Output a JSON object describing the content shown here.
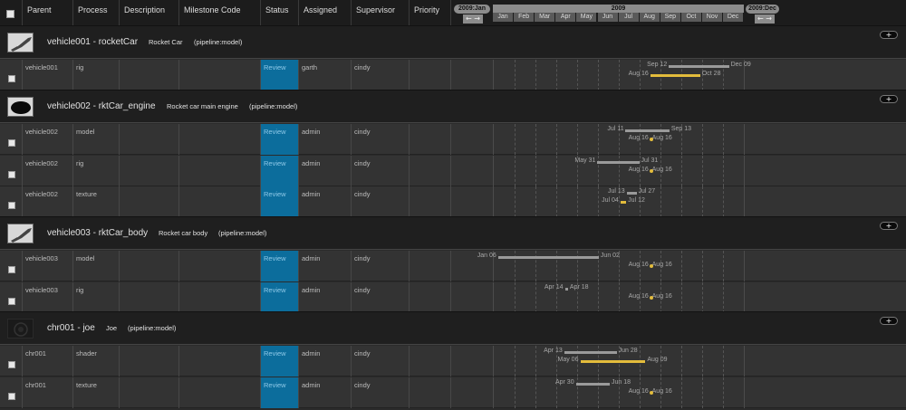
{
  "columns": {
    "parent": "Parent",
    "process": "Process",
    "description": "Description",
    "milestone": "Milestone Code",
    "status": "Status",
    "assigned": "Assigned",
    "supervisor": "Supervisor",
    "priority": "Priority"
  },
  "timeline": {
    "start_label": "2009:Jan",
    "end_label": "2009:Dec",
    "year": "2009",
    "arrows": "← →",
    "months": [
      "Jan",
      "Feb",
      "Mar",
      "Apr",
      "May",
      "Jun",
      "Jul",
      "Aug",
      "Sep",
      "Oct",
      "Nov",
      "Dec"
    ]
  },
  "add_label": "+",
  "colors": {
    "status_review": "#0c6d9c",
    "bar_gold": "#e3bc3c",
    "bar_grey": "#9a9a9a"
  },
  "groups": [
    {
      "title": "vehicle001 - rocketCar",
      "description": "Rocket Car",
      "type": "(pipeline:model)",
      "thumb": "rocket-car-thumbnail",
      "rows": [
        {
          "parent": "vehicle001",
          "process": "rig",
          "status": "Review",
          "assigned": "garth",
          "supervisor": "cindy",
          "line1": {
            "start": "Sep 12",
            "end": "Dec 09"
          },
          "line2": {
            "start": "Aug 16",
            "end": "Oct 28"
          }
        }
      ]
    },
    {
      "title": "vehicle002 - rktCar_engine",
      "description": "Rocket car main engine",
      "type": "(pipeline:model)",
      "thumb": "engine-thumbnail",
      "rows": [
        {
          "parent": "vehicle002",
          "process": "model",
          "status": "Review",
          "assigned": "admin",
          "supervisor": "cindy",
          "line1": {
            "start": "Jul 11",
            "end": "Sep 13"
          },
          "line2": {
            "start": "Aug 16",
            "end": "Aug 16"
          }
        },
        {
          "parent": "vehicle002",
          "process": "rig",
          "status": "Review",
          "assigned": "admin",
          "supervisor": "cindy",
          "line1": {
            "start": "May 31",
            "end": "Jul 31"
          },
          "line2": {
            "start": "Aug 16",
            "end": "Aug 16"
          }
        },
        {
          "parent": "vehicle002",
          "process": "texture",
          "status": "Review",
          "assigned": "admin",
          "supervisor": "cindy",
          "line1": {
            "start": "Jul 13",
            "end": "Jul 27"
          },
          "line2": {
            "start": "Jul 04",
            "end": "Jul 12"
          }
        }
      ]
    },
    {
      "title": "vehicle003 - rktCar_body",
      "description": "Rocket car body",
      "type": "(pipeline:model)",
      "thumb": "car-body-thumbnail",
      "rows": [
        {
          "parent": "vehicle003",
          "process": "model",
          "status": "Review",
          "assigned": "admin",
          "supervisor": "cindy",
          "line1": {
            "start": "Jan 06",
            "end": "Jun 02"
          },
          "line2": {
            "start": "Aug 16",
            "end": "Aug 16"
          }
        },
        {
          "parent": "vehicle003",
          "process": "rig",
          "status": "Review",
          "assigned": "admin",
          "supervisor": "cindy",
          "line1": {
            "start": "Apr 14",
            "end": "Apr 18"
          },
          "line2": {
            "start": "Aug 16",
            "end": "Aug 16"
          }
        }
      ]
    },
    {
      "title": "chr001 - joe",
      "description": "Joe",
      "type": "(pipeline:model)",
      "thumb": "character-thumbnail",
      "rows": [
        {
          "parent": "chr001",
          "process": "shader",
          "status": "Review",
          "assigned": "admin",
          "supervisor": "cindy",
          "line1": {
            "start": "Apr 13",
            "end": "Jun 28"
          },
          "line2": {
            "start": "May 06",
            "end": "Aug 09"
          }
        },
        {
          "parent": "chr001",
          "process": "texture",
          "status": "Review",
          "assigned": "admin",
          "supervisor": "cindy",
          "line1": {
            "start": "Apr 30",
            "end": "Jun 18"
          },
          "line2": {
            "start": "Aug 16",
            "end": "Aug 16"
          }
        }
      ]
    }
  ]
}
